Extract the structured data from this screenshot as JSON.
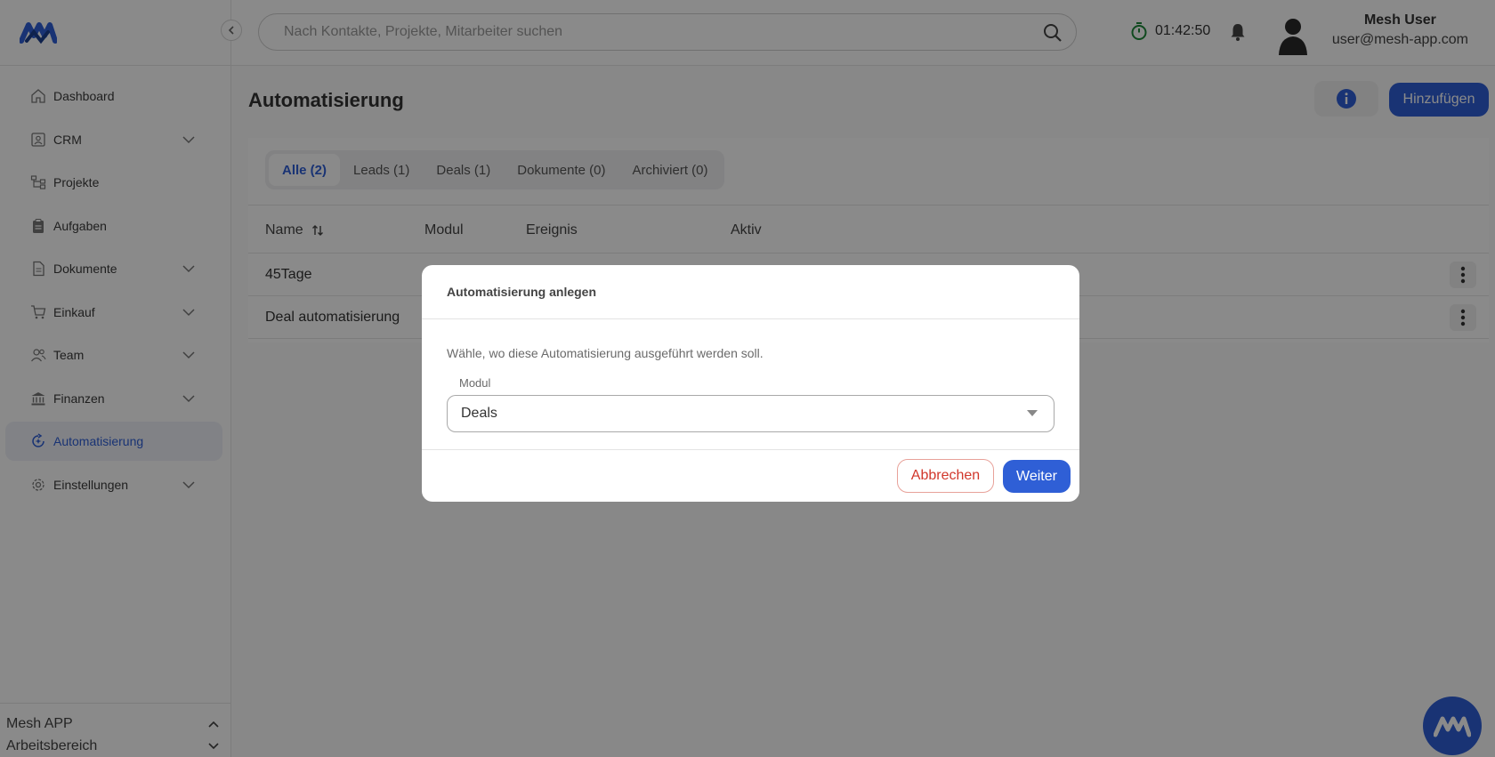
{
  "colors": {
    "accent": "#2f5fd6",
    "danger": "#d1372b",
    "timer": "#1f8a3a"
  },
  "sidebar": {
    "items": [
      {
        "label": "Dashboard",
        "icon": "home-icon",
        "expandable": false
      },
      {
        "label": "CRM",
        "icon": "contact-card-icon",
        "expandable": true
      },
      {
        "label": "Projekte",
        "icon": "project-tree-icon",
        "expandable": false
      },
      {
        "label": "Aufgaben",
        "icon": "clipboard-icon",
        "expandable": false
      },
      {
        "label": "Dokumente",
        "icon": "document-icon",
        "expandable": true
      },
      {
        "label": "Einkauf",
        "icon": "cart-icon",
        "expandable": true
      },
      {
        "label": "Team",
        "icon": "team-icon",
        "expandable": true
      },
      {
        "label": "Finanzen",
        "icon": "bank-icon",
        "expandable": true
      },
      {
        "label": "Automatisierung",
        "icon": "automation-icon",
        "expandable": false,
        "active": true
      },
      {
        "label": "Einstellungen",
        "icon": "gear-icon",
        "expandable": true
      }
    ],
    "workspace": {
      "name": "Mesh APP",
      "sub": "Arbeitsbereich"
    }
  },
  "header": {
    "search_placeholder": "Nach Kontakte, Projekte, Mitarbeiter suchen",
    "timer": "01:42:50",
    "user_name": "Mesh User",
    "user_email": "user@mesh-app.com"
  },
  "main": {
    "title": "Automatisierung",
    "add_label": "Hinzufügen",
    "tabs": [
      "Alle (2)",
      "Leads (1)",
      "Deals (1)",
      "Dokumente (0)",
      "Archiviert (0)"
    ],
    "columns": [
      "Name",
      "Modul",
      "Ereignis",
      "Aktiv"
    ],
    "rows": [
      {
        "name": "45Tage"
      },
      {
        "name": "Deal automatisierung"
      }
    ]
  },
  "modal": {
    "title": "Automatisierung anlegen",
    "description": "Wähle, wo diese Automatisierung ausgeführt werden soll.",
    "field_label": "Modul",
    "field_value": "Deals",
    "cancel_label": "Abbrechen",
    "next_label": "Weiter"
  }
}
